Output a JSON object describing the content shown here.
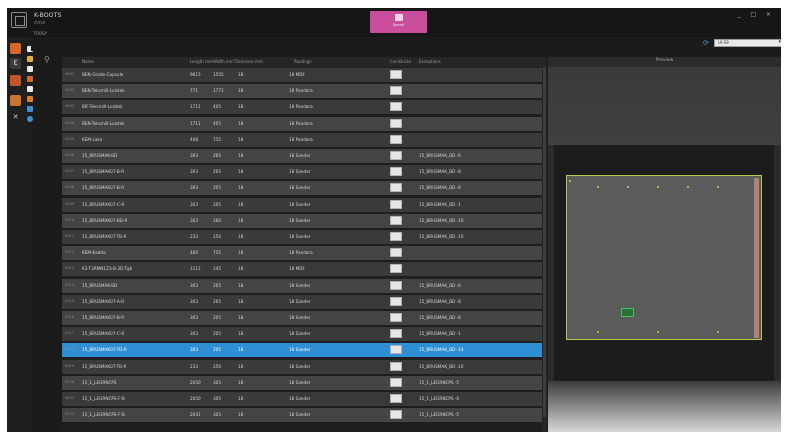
{
  "titlebar": {
    "app_title": "K-BOOTS",
    "app_subtitle": "ctmel",
    "menu_label": "TOOGY",
    "center_button_label": "Speed",
    "window_controls": "_ □ ×"
  },
  "toolbar": {
    "layout_value": "UI-S9"
  },
  "table": {
    "columns": [
      "Name",
      "Length mm",
      "Width mm",
      "Thickness mm",
      "Routings",
      "Con-Bricks",
      "Exceptions"
    ],
    "rows": [
      {
        "num": "0001",
        "name": "BEN-Grade-Capsule",
        "length": "9615",
        "width": "1555",
        "thickness": "18",
        "routing": "18 MDF",
        "checked": true,
        "exc": ""
      },
      {
        "num": "0002",
        "name": "BEN-Teksmill-Loistek",
        "length": "771",
        "width": "1771",
        "thickness": "18",
        "routing": "18 Pandora",
        "checked": true,
        "exc": ""
      },
      {
        "num": "0003",
        "name": "BIF-Teksmill-Loistek",
        "length": "1711",
        "width": "405",
        "thickness": "18",
        "routing": "18 Pandora",
        "checked": true,
        "exc": ""
      },
      {
        "num": "0004",
        "name": "BEN-Teksmill-Loistek",
        "length": "1711",
        "width": "405",
        "thickness": "18",
        "routing": "18 Pandora",
        "checked": true,
        "exc": ""
      },
      {
        "num": "0005",
        "name": "KEM-Lake",
        "length": "408",
        "width": "755",
        "thickness": "18",
        "routing": "18 Pandora",
        "checked": true,
        "exc": ""
      },
      {
        "num": "0006",
        "name": "15_BRUSMAK-BD",
        "length": "303",
        "width": "265",
        "thickness": "18",
        "routing": "18 Sander",
        "checked": true,
        "exc": "15_BRUSMAK_BD -6"
      },
      {
        "num": "0007",
        "name": "15_BRUSMAK07-B-R",
        "length": "303",
        "width": "265",
        "thickness": "18",
        "routing": "18 Sander",
        "checked": true,
        "exc": "15_BRUSMAK_BD -8"
      },
      {
        "num": "0008",
        "name": "15_BRUSMAK07-B-R",
        "length": "303",
        "width": "205",
        "thickness": "18",
        "routing": "18 Sander",
        "checked": true,
        "exc": "15_BRUSMAK_BD -8"
      },
      {
        "num": "0009",
        "name": "15_BRUSMAK07-C-R",
        "length": "303",
        "width": "205",
        "thickness": "18",
        "routing": "18 Sander",
        "checked": true,
        "exc": "15_BRUSMAK_BD -1"
      },
      {
        "num": "0010",
        "name": "15_BRUSMAK07-BD-R",
        "length": "303",
        "width": "260",
        "thickness": "18",
        "routing": "18 Sander",
        "checked": true,
        "exc": "15_BRUSMAK_BD -10"
      },
      {
        "num": "0011",
        "name": "15_BRUSMAK07-TB-R",
        "length": "233",
        "width": "250",
        "thickness": "18",
        "routing": "18 Sander",
        "checked": true,
        "exc": "15_BRUSMAK_BD -10"
      },
      {
        "num": "0012",
        "name": "KEM-Kadda",
        "length": "400",
        "width": "755",
        "thickness": "18",
        "routing": "18 Pandora",
        "checked": true,
        "exc": ""
      },
      {
        "num": "0013",
        "name": "K3-T3RMN1Z3-B-3D-Tgb",
        "length": "1111",
        "width": "245",
        "thickness": "18",
        "routing": "18 MDF",
        "checked": true,
        "exc": ""
      },
      {
        "num": "0014",
        "name": "15_BRUSMAK-BD",
        "length": "303",
        "width": "265",
        "thickness": "18",
        "routing": "18 Sander",
        "checked": true,
        "exc": "15_BRUSMAK_BD -6"
      },
      {
        "num": "0015",
        "name": "15_BRUSMAK07-A-R",
        "length": "303",
        "width": "265",
        "thickness": "18",
        "routing": "18 Sander",
        "checked": true,
        "exc": "15_BRUSMAK_BD -8"
      },
      {
        "num": "0016",
        "name": "15_BRUSMAK07-B-R",
        "length": "303",
        "width": "205",
        "thickness": "18",
        "routing": "18 Sander",
        "checked": true,
        "exc": "15_BRUSMAK_BD -8"
      },
      {
        "num": "0017",
        "name": "15_BRUSMAK07-C-R",
        "length": "303",
        "width": "205",
        "thickness": "18",
        "routing": "18 Sander",
        "checked": true,
        "exc": "15_BRUSMAK_BD -1"
      },
      {
        "num": "0018",
        "name": "15_BRUSMAK07-TD-R",
        "length": "303",
        "width": "205",
        "thickness": "18",
        "routing": "18 Sander",
        "checked": true,
        "exc": "15_BRUSMAK_BD -14",
        "selected": true
      },
      {
        "num": "0019",
        "name": "15_BRUSMAK07-TB-R",
        "length": "233",
        "width": "250",
        "thickness": "18",
        "routing": "18 Sander",
        "checked": true,
        "exc": "15_BRUSMAK_BD -10"
      },
      {
        "num": "0020",
        "name": "15_1_LEGRNCPS",
        "length": "2050",
        "width": "305",
        "thickness": "18",
        "routing": "18 Sander",
        "checked": true,
        "exc": "15_1_LEGRNCPS -5"
      },
      {
        "num": "0021",
        "name": "15_1_LEGRNCPS-F-B",
        "length": "2050",
        "width": "305",
        "thickness": "18",
        "routing": "18 Sander",
        "checked": true,
        "exc": "15_1_LEGRNCPS -6"
      },
      {
        "num": "0022",
        "name": "15_1_LEGRNCPS-F-B",
        "length": "2041",
        "width": "305",
        "thickness": "18",
        "routing": "18 Sander",
        "checked": true,
        "exc": "15_1_LEGRNCPS -5"
      }
    ]
  },
  "preview": {
    "title": "Preview"
  },
  "colors": {
    "accent_pink": "#c94f9c",
    "selection_blue": "#2f8fd4",
    "board_outline": "#b6c64a"
  }
}
